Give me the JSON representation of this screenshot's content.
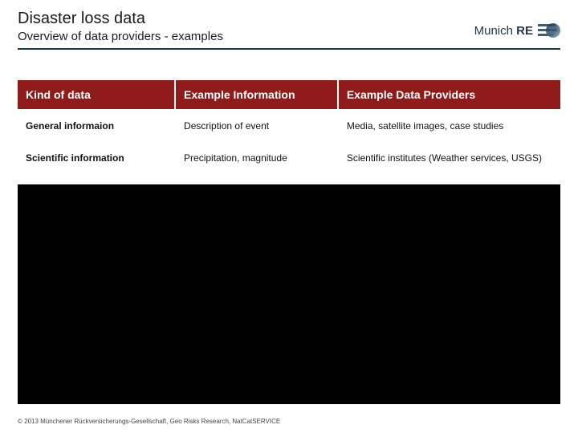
{
  "header": {
    "title": "Disaster loss data",
    "subtitle": "Overview of data providers - examples"
  },
  "logo": {
    "text_left": "Munich",
    "text_right": "RE"
  },
  "table": {
    "headers": [
      "Kind of data",
      "Example Information",
      "Example Data Providers"
    ],
    "rows": [
      {
        "kind": "General informaion",
        "info": "Description of event",
        "providers": "Media, satellite images, case studies"
      },
      {
        "kind": "Scientific information",
        "info": "Precipitation, magnitude",
        "providers": "Scientific institutes (Weather services, USGS)"
      }
    ]
  },
  "footer": {
    "text": "© 2013 Münchener Rückversicherungs-Gesellschaft, Geo Risks Research, NatCatSERVICE"
  }
}
